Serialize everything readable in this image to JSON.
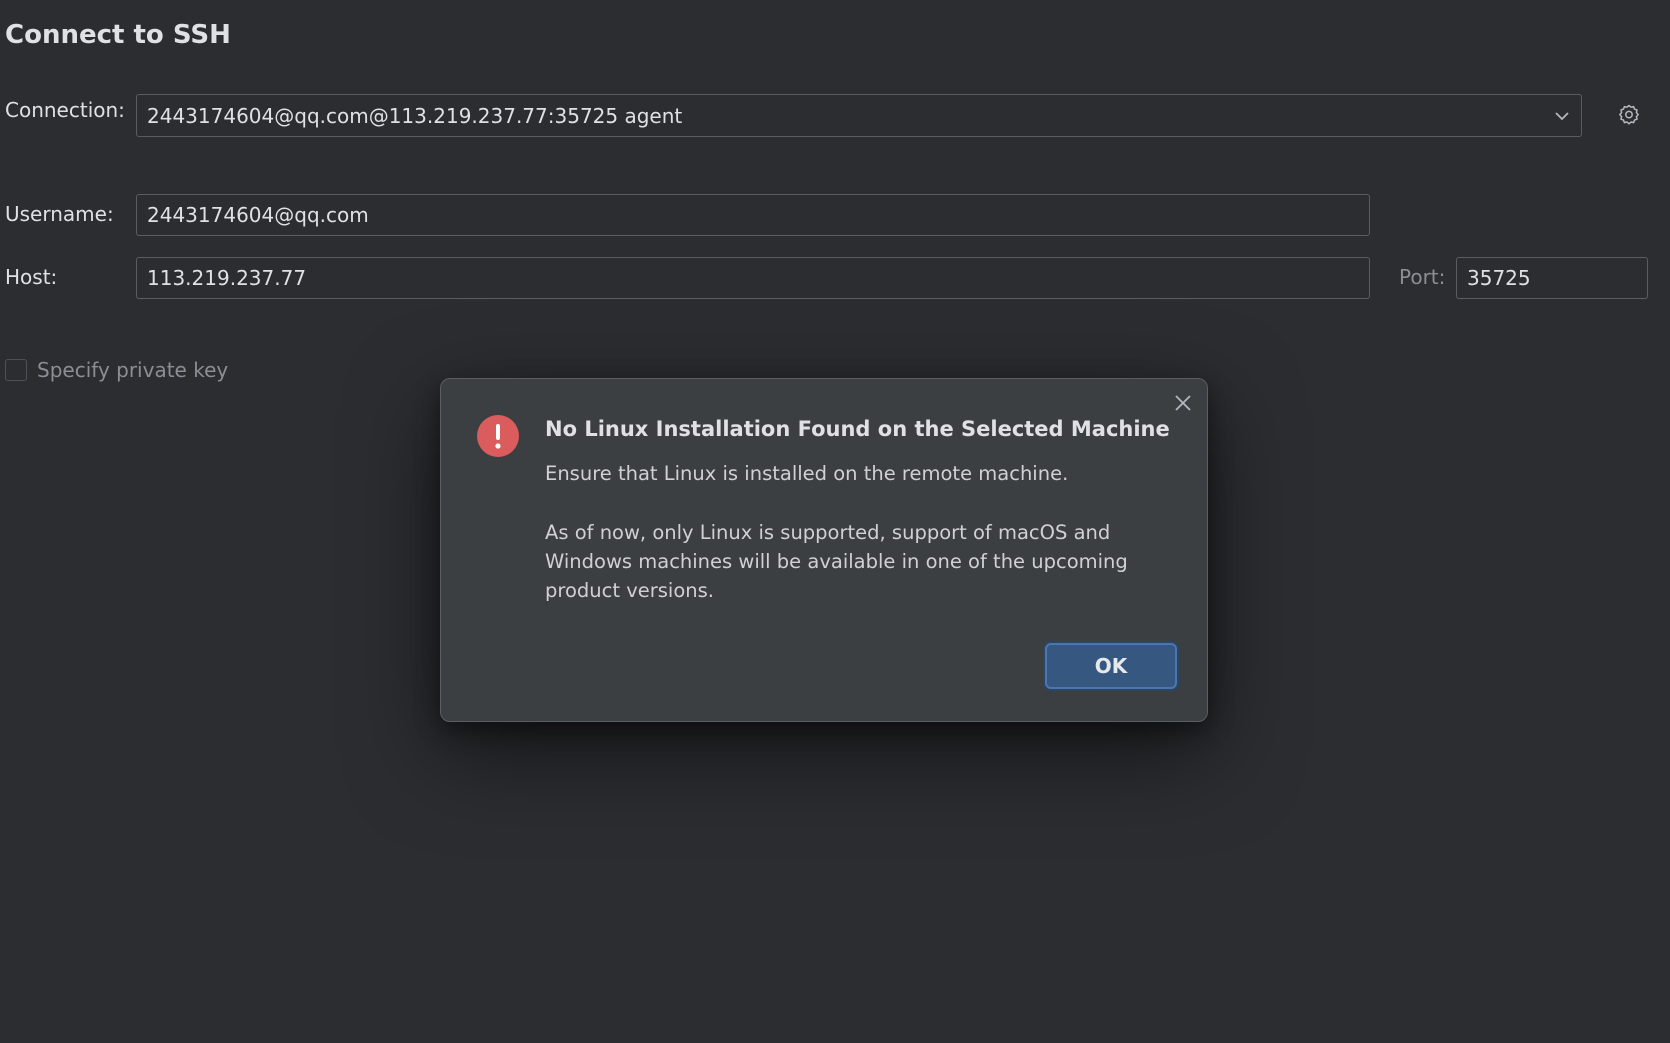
{
  "page": {
    "title": "Connect to SSH"
  },
  "form": {
    "connection_label": "Connection:",
    "connection_value": "2443174604@qq.com@113.219.237.77:35725 agent",
    "username_label": "Username:",
    "username_value": "2443174604@qq.com",
    "host_label": "Host:",
    "host_value": "113.219.237.77",
    "port_label": "Port:",
    "port_value": "35725",
    "private_key_label": "Specify private key",
    "private_key_checked": false
  },
  "dialog": {
    "title": "No Linux Installation Found on the Selected Machine",
    "message_line": "Ensure that Linux is installed on the remote machine.",
    "message_detail": "As of now, only Linux is supported, support of macOS and Windows machines will be available in one of the upcoming product versions.",
    "ok_label": "OK",
    "icon": "error-icon"
  },
  "icons": {
    "dropdown": "chevron-down-icon",
    "settings": "gear-icon",
    "close": "close-icon"
  },
  "colors": {
    "background": "#2b2d30",
    "dialog_background": "#3c3f41",
    "error": "#db5c5c",
    "primary_button": "#365880"
  }
}
